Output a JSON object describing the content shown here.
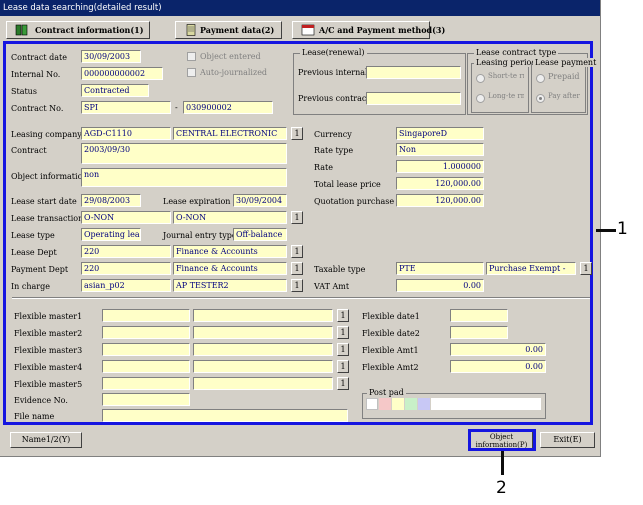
{
  "window": {
    "title": "Lease data searching(detailed result)"
  },
  "tabs": [
    {
      "label": "Contract information(1)"
    },
    {
      "label": "Payment data(2)"
    },
    {
      "label": "A/C and Payment method(3)"
    }
  ],
  "contract": {
    "contract_date_label": "Contract date",
    "contract_date": "30/09/2003",
    "internal_no_label": "Internal No.",
    "internal_no": "000000000002",
    "status_label": "Status",
    "status": "Contracted",
    "contract_no_label": "Contract No.",
    "contract_no_1": "SPI",
    "contract_no_dash": "-",
    "contract_no_2": "030900002",
    "object_entered_label": "Object entered",
    "auto_journalized_label": "Auto-journalized"
  },
  "renewal": {
    "group_label": "Lease(renewal)",
    "previous_internal_label": "Previous internal",
    "previous_internal": "",
    "previous_contract_label": "Previous contract",
    "previous_contract": ""
  },
  "contract_type": {
    "group_label": "Lease contract type",
    "leasing_period_label": "Leasing period",
    "short_term_label": "Short-te rm",
    "long_term_label": "Long-te rm",
    "lease_payment_label": "Lease payment",
    "prepaid_label": "Prepaid",
    "pay_after_label": "Pay after"
  },
  "details": {
    "leasing_company_label": "Leasing company",
    "leasing_company_code": "AGD-C1110",
    "leasing_company_name": "CENTRAL ELECTRONIC",
    "contract_label": "Contract",
    "contract_value": "2003/09/30",
    "object_information_label": "Object information",
    "object_information": "non",
    "lease_start_label": "Lease start date",
    "lease_start": "29/08/2003",
    "lease_expiration_label": "Lease expiration",
    "lease_expiration": "30/09/2004",
    "lease_transaction_label": "Lease transaction",
    "lease_transaction_code": "O-NON",
    "lease_transaction_name": "O-NON",
    "lease_type_label": "Lease type",
    "lease_type": "Operating lease",
    "journal_entry_type_label": "Journal entry type",
    "journal_entry_type": "Off-balance",
    "lease_dept_label": "Lease Dept",
    "lease_dept_code": "220",
    "lease_dept_name": "Finance & Accounts",
    "payment_dept_label": "Payment Dept",
    "payment_dept_code": "220",
    "payment_dept_name": "Finance & Accounts",
    "in_charge_label": "In charge",
    "in_charge_code": "asian_p02",
    "in_charge_name": "AP TESTER2",
    "currency_label": "Currency",
    "currency": "SingaporeD",
    "rate_type_label": "Rate type",
    "rate_type": "Non",
    "rate_label": "Rate",
    "rate": "1.000000",
    "total_lease_price_label": "Total lease price",
    "total_lease_price": "120,000.00",
    "quotation_purchase_label": "Quotation purchase",
    "quotation_purchase": "120,000.00",
    "taxable_type_label": "Taxable type",
    "taxable_type_code": "PTE",
    "taxable_type_name": "Purchase Exempt -",
    "vat_amt_label": "VAT Amt",
    "vat_amt": "0.00",
    "lookup_label": "1"
  },
  "flexible": {
    "master1_label": "Flexible master1",
    "master2_label": "Flexible master2",
    "master3_label": "Flexible master3",
    "master4_label": "Flexible master4",
    "master5_label": "Flexible master5",
    "evidence_label": "Evidence No.",
    "file_name_label": "File name",
    "date1_label": "Flexible date1",
    "date2_label": "Flexible date2",
    "amt1_label": "Flexible Amt1",
    "amt1": "0.00",
    "amt2_label": "Flexible Amt2",
    "amt2": "0.00",
    "post_pad_label": "Post pad"
  },
  "footer": {
    "name_button": "Name1/2(Y)",
    "object_info_button": "Object information(P)",
    "exit_button": "Exit(E)"
  },
  "callouts": {
    "main": "1",
    "object_button": "2"
  },
  "colors": {
    "field_bg": "#ffffc8",
    "highlight": "#1515e0",
    "titlebar": "#0a246a"
  }
}
